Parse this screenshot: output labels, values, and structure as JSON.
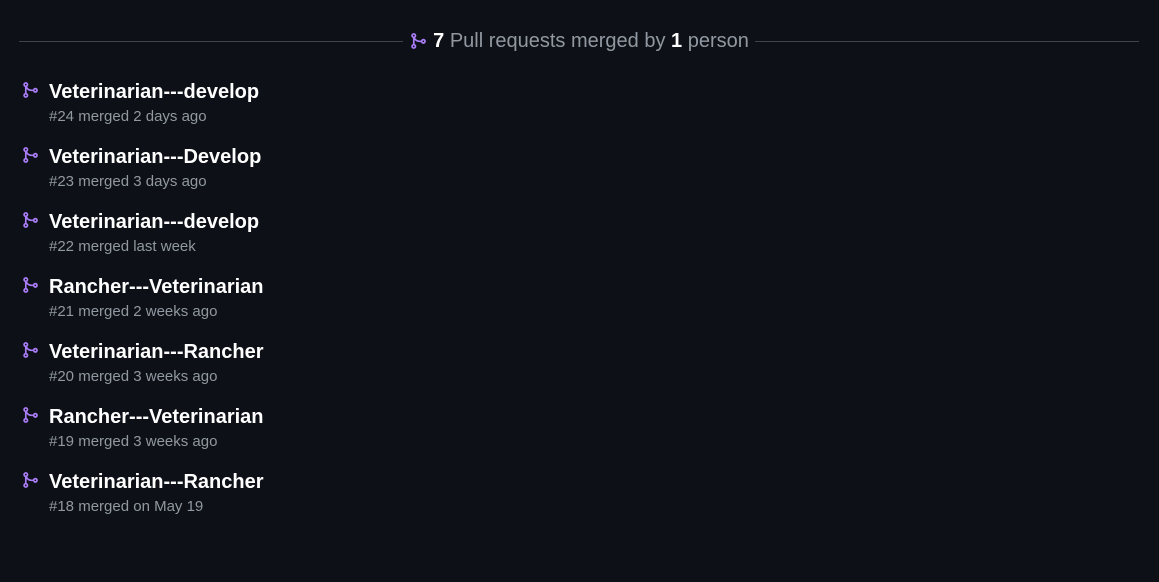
{
  "summary": {
    "count": "7",
    "text_before": "Pull requests merged by",
    "people_count": "1",
    "text_after": "person",
    "icon": "git-merge-icon"
  },
  "colors": {
    "background": "#0d1117",
    "merge_icon": "#ab7df8",
    "title": "#ffffff",
    "muted": "#9198a1"
  },
  "pull_requests": [
    {
      "title": "Veterinarian---develop",
      "meta": "#24 merged 2 days ago"
    },
    {
      "title": "Veterinarian---Develop",
      "meta": "#23 merged 3 days ago"
    },
    {
      "title": "Veterinarian---develop",
      "meta": "#22 merged last week"
    },
    {
      "title": "Rancher---Veterinarian",
      "meta": "#21 merged 2 weeks ago"
    },
    {
      "title": "Veterinarian---Rancher",
      "meta": "#20 merged 3 weeks ago"
    },
    {
      "title": "Rancher---Veterinarian",
      "meta": "#19 merged 3 weeks ago"
    },
    {
      "title": "Veterinarian---Rancher",
      "meta": "#18 merged on May 19"
    }
  ]
}
